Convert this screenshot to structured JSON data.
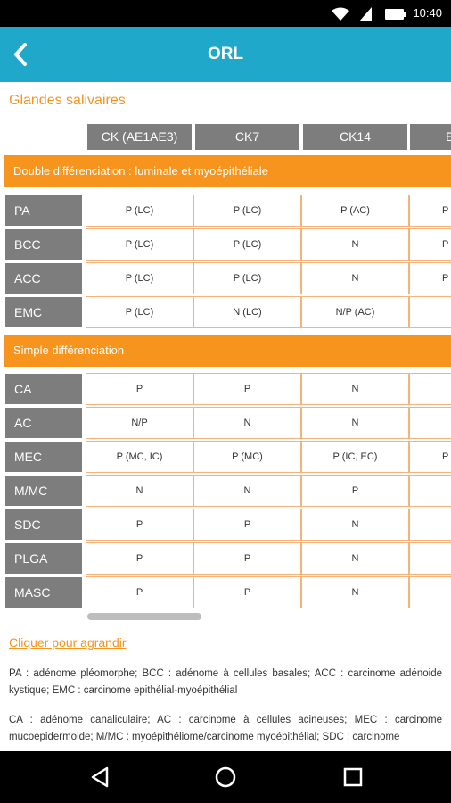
{
  "status": {
    "time": "10:40"
  },
  "header": {
    "title": "ORL"
  },
  "section_title": "Glandes salivaires",
  "columns": [
    "CK (AE1AE3)",
    "CK7",
    "CK14",
    "E"
  ],
  "groups": [
    {
      "label": "Double différenciation : luminale et myoépithéliale"
    },
    {
      "label": "Simple différenciation"
    }
  ],
  "rows": [
    {
      "label": "PA",
      "cells": [
        "P (LC)",
        "P (LC)",
        "P (AC)",
        "P"
      ]
    },
    {
      "label": "BCC",
      "cells": [
        "P (LC)",
        "P (LC)",
        "N",
        "P"
      ]
    },
    {
      "label": "ACC",
      "cells": [
        "P (LC)",
        "P (LC)",
        "N",
        "P"
      ]
    },
    {
      "label": "EMC",
      "cells": [
        "P (LC)",
        "N (LC)",
        "N/P (AC)",
        ""
      ]
    },
    {
      "label": "CA",
      "cells": [
        "P",
        "P",
        "N",
        ""
      ]
    },
    {
      "label": "AC",
      "cells": [
        "N/P",
        "N",
        "N",
        ""
      ]
    },
    {
      "label": "MEC",
      "cells": [
        "P (MC, IC)",
        "P (MC)",
        "P (IC, EC)",
        "P"
      ]
    },
    {
      "label": "M/MC",
      "cells": [
        "N",
        "N",
        "P",
        ""
      ]
    },
    {
      "label": "SDC",
      "cells": [
        "P",
        "P",
        "N",
        ""
      ]
    },
    {
      "label": "PLGA",
      "cells": [
        "P",
        "P",
        "N",
        ""
      ]
    },
    {
      "label": "MASC",
      "cells": [
        "P",
        "P",
        "N",
        ""
      ]
    }
  ],
  "link": "Cliquer pour agrandir",
  "legend1": "PA : adénome pléomorphe; BCC : adénome à cellules basales; ACC : carcinome adénoide kystique; EMC : carcinome epithélial-myoépithélial",
  "legend2": "CA : adénome canaliculaire; AC : carcinome à cellules acineuses; MEC : carcinome mucoepidermoide; M/MC : myoépithéliome/carcinome myoépithélial; SDC : carcinome"
}
